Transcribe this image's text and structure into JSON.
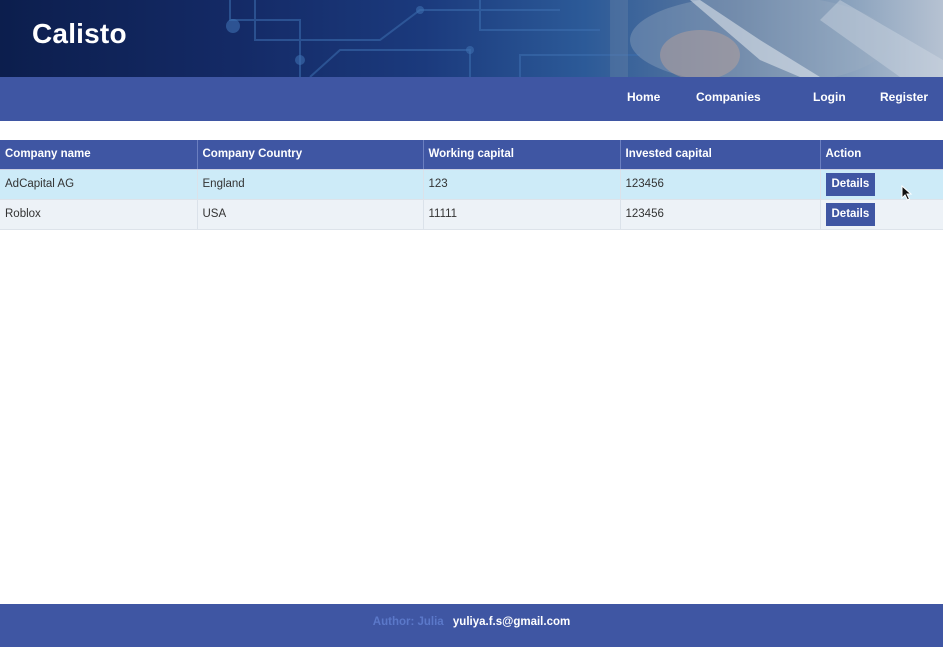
{
  "header": {
    "brand": "Calisto"
  },
  "nav": {
    "home": "Home",
    "companies": "Companies",
    "login": "Login",
    "register": "Register"
  },
  "table": {
    "columns": [
      "Company name",
      "Company Country",
      "Working capital",
      "Invested capital",
      "Action"
    ],
    "rows": [
      {
        "name": "AdCapital AG",
        "country": "England",
        "working": "123",
        "invested": "123456",
        "action": "Details"
      },
      {
        "name": "Roblox",
        "country": "USA",
        "working": "11111",
        "invested": "123456",
        "action": "Details"
      }
    ]
  },
  "footer": {
    "author": "Author: Julia",
    "email": "yuliya.f.s@gmail.com"
  },
  "colors": {
    "primary": "#3f56a3",
    "row_highlight": "#cdebf8",
    "row_plain": "#edf2f7"
  }
}
